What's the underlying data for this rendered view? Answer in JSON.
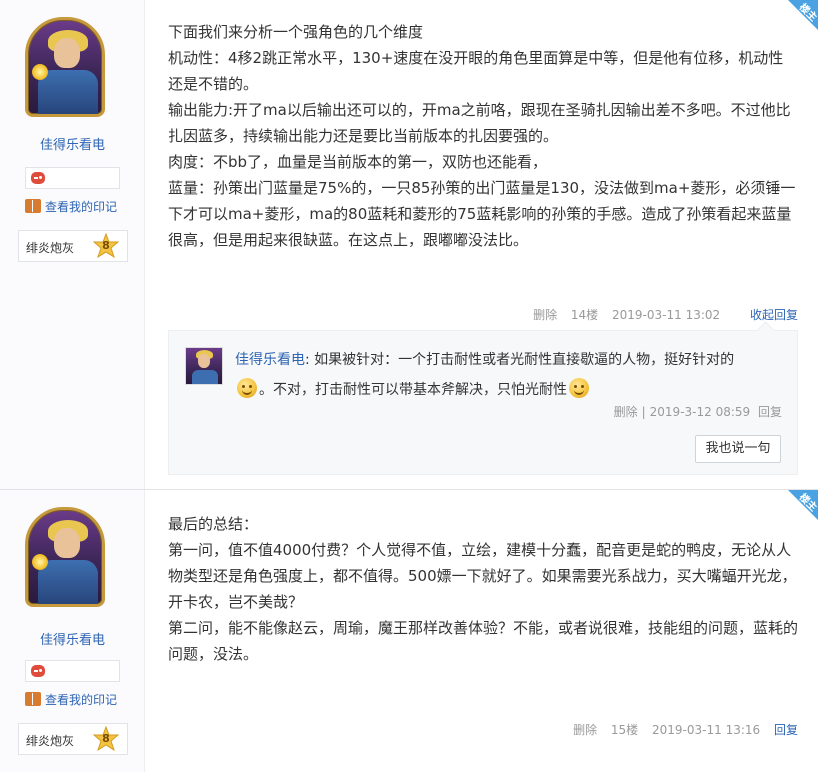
{
  "posts": [
    {
      "badge": "楼主",
      "username": "佳得乐看电",
      "mark_link": "查看我的印记",
      "level_name": "绯炎炮灰",
      "level_num": "8",
      "paragraphs": [
        "下面我们来分析一个强角色的几个维度",
        "机动性：4移2跳正常水平，130+速度在没开眼的角色里面算是中等，但是他有位移，机动性还是不错的。",
        "输出能力:开了ma以后输出还可以的，开ma之前咯，跟现在圣骑扎因输出差不多吧。不过他比扎因蓝多，持续输出能力还是要比当前版本的扎因要强的。",
        "肉度：不bb了，血量是当前版本的第一，双防也还能看，",
        "蓝量：孙策出门蓝量是75%的，一只85孙策的出门蓝量是130，没法做到ma+菱形，必须锤一下才可以ma+菱形，ma的80蓝耗和菱形的75蓝耗影响的孙策的手感。造成了孙策看起来蓝量很高，但是用起来很缺蓝。在这点上，跟嘟嘟没法比。"
      ],
      "tail": {
        "delete": "删除",
        "floor": "14楼",
        "time": "2019-03-11 13:02",
        "collapse_reply": "收起回复"
      },
      "reply": {
        "user": "佳得乐看电",
        "colon": ":",
        "text_1": "如果被针对：一个打击耐性或者光耐性直接歇逼的人物，挺好针对的",
        "text_2": "。不对，打击耐性可以带基本斧解决，只怕光耐性",
        "delete": "删除",
        "sep": "|",
        "time": "2019-3-12 08:59",
        "reply": "回复",
        "say_button": "我也说一句"
      }
    },
    {
      "badge": "楼主",
      "username": "佳得乐看电",
      "mark_link": "查看我的印记",
      "level_name": "绯炎炮灰",
      "level_num": "8",
      "paragraphs": [
        "最后的总结：",
        "第一问，值不值4000付费？个人觉得不值，立绘，建模十分蠢，配音更是蛇的鸭皮，无论从人物类型还是角色强度上，都不值得。500嫖一下就好了。如果需要光系战力，买大嘴蝠开光龙，开卡农，岂不美哉？",
        "第二问，能不能像赵云，周瑜，魔王那样改善体验？不能，或者说很难，技能组的问题，蓝耗的问题，没法。"
      ],
      "tail": {
        "delete": "删除",
        "floor": "15楼",
        "time": "2019-03-11 13:16",
        "reply": "回复"
      }
    }
  ],
  "colors": {
    "link": "#2d64b3",
    "badge": "#4aa2e2",
    "meta": "#999999"
  }
}
